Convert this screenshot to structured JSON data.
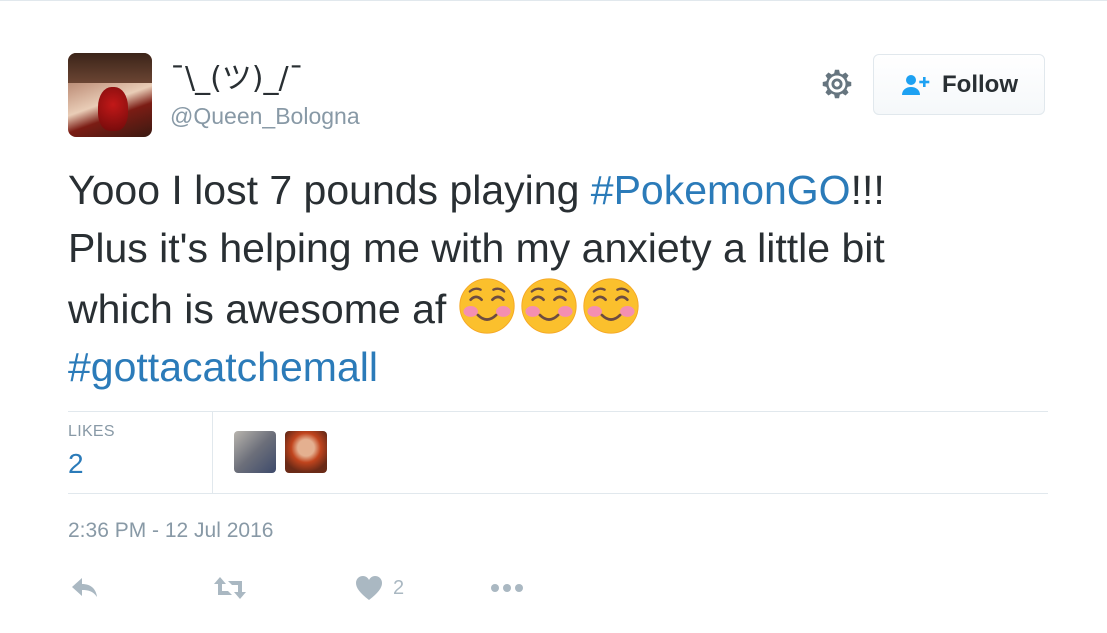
{
  "user": {
    "display_name": "¯\\_(ツ)_/¯",
    "handle": "@Queen_Bologna"
  },
  "header": {
    "follow_label": "Follow",
    "gear_icon": "gear-icon",
    "follow_icon": "add-user-icon"
  },
  "tweet": {
    "line1_a": "Yooo I lost 7 pounds playing ",
    "hashtag1": "#PokemonGO",
    "line1_b": "!!!",
    "line2": "Plus it's helping me with my anxiety a little bit",
    "line3": "which is awesome af ",
    "emoji_count": 3,
    "hashtag2": "#gottacatchemall"
  },
  "stats": {
    "likes_label": "LIKES",
    "likes_count": "2"
  },
  "meta": {
    "timestamp": "2:36 PM - 12 Jul 2016"
  },
  "actions": {
    "like_count": "2",
    "icons": [
      "reply-icon",
      "retweet-icon",
      "heart-icon",
      "more-icon"
    ]
  },
  "colors": {
    "link": "#2b7bb9",
    "muted": "#8899a6",
    "action": "#aab8c2",
    "text": "#292f33"
  }
}
